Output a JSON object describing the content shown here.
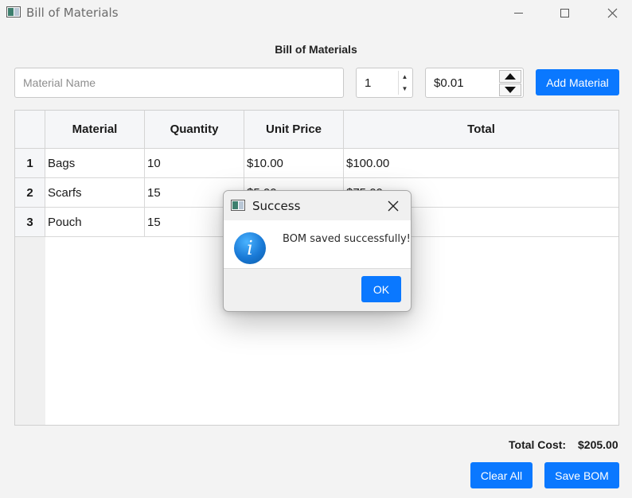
{
  "window": {
    "title": "Bill of Materials"
  },
  "page": {
    "heading": "Bill of Materials"
  },
  "form": {
    "material_placeholder": "Material Name",
    "material_value": "",
    "quantity": "1",
    "unit_price": "$0.01",
    "add_label": "Add Material"
  },
  "table": {
    "columns": [
      "Material",
      "Quantity",
      "Unit Price",
      "Total"
    ],
    "rows": [
      {
        "num": "1",
        "material": "Bags",
        "quantity": "10",
        "unit_price": "$10.00",
        "total": "$100.00"
      },
      {
        "num": "2",
        "material": "Scarfs",
        "quantity": "15",
        "unit_price": "$5.00",
        "total": "$75.00"
      },
      {
        "num": "3",
        "material": "Pouch",
        "quantity": "15",
        "unit_price": "",
        "total": ""
      }
    ]
  },
  "footer": {
    "total_label": "Total Cost:",
    "total_value": "$205.00",
    "clear_label": "Clear All",
    "save_label": "Save BOM"
  },
  "dialog": {
    "title": "Success",
    "message": "BOM saved successfully!",
    "ok_label": "OK",
    "icon": "info-icon"
  },
  "colors": {
    "accent": "#0a78ff",
    "info_icon": "#1979d6"
  }
}
